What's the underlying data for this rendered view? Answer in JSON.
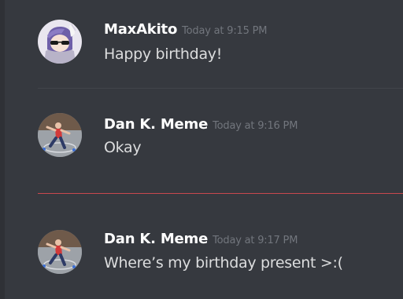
{
  "messages": [
    {
      "author": "MaxAkito",
      "timestamp": "Today at 9:15 PM",
      "text": "Happy birthday!",
      "avatar_icon": "anime-avatar-icon"
    },
    {
      "author": "Dan K. Meme",
      "timestamp": "Today at 9:16 PM",
      "text": "Okay",
      "avatar_icon": "dancer-avatar-icon"
    },
    {
      "author": "Dan K. Meme",
      "timestamp": "Today at 9:17 PM",
      "text": "Where’s my birthday present >:(",
      "avatar_icon": "dancer-avatar-icon"
    }
  ],
  "colors": {
    "background": "#36393f",
    "username": "#ffffff",
    "timestamp": "#72767d",
    "message_text": "#dcddde",
    "new_messages_divider": "#c9484e"
  }
}
